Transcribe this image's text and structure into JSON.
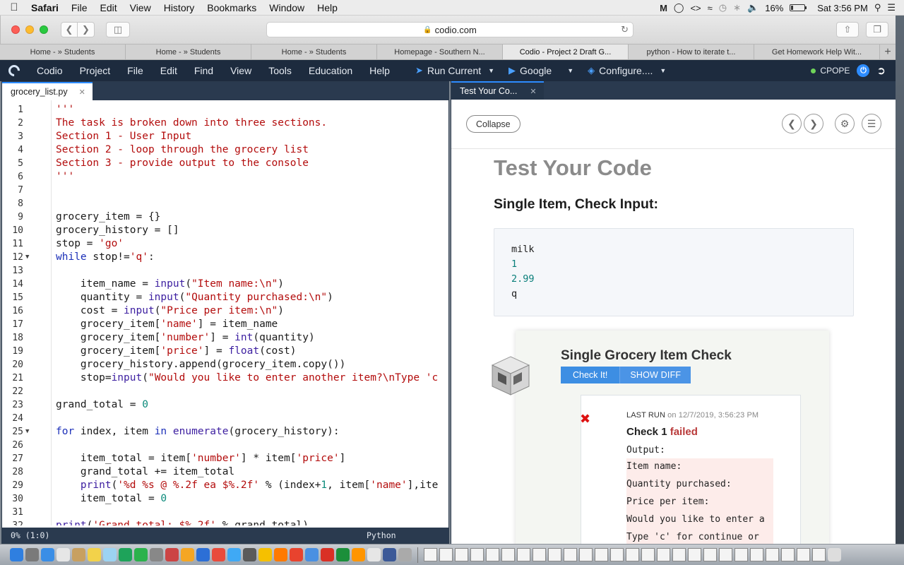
{
  "mac_menubar": {
    "app_name": "Safari",
    "menus": [
      "File",
      "Edit",
      "View",
      "History",
      "Bookmarks",
      "Window",
      "Help"
    ],
    "battery_percent": "16%",
    "battery_level": 0.16,
    "clock": "Sat 3:56 PM"
  },
  "safari": {
    "url": "codio.com",
    "tabs": [
      {
        "label": "Home - » Students",
        "active": false
      },
      {
        "label": "Home - » Students",
        "active": false
      },
      {
        "label": "Home - » Students",
        "active": false
      },
      {
        "label": "Homepage - Southern N...",
        "active": false
      },
      {
        "label": "Codio - Project 2 Draft G...",
        "active": true
      },
      {
        "label": "python - How to iterate t...",
        "active": false
      },
      {
        "label": "Get Homework Help Wit...",
        "active": false
      }
    ],
    "new_tab_label": "+"
  },
  "codio": {
    "menus": [
      "Codio",
      "Project",
      "File",
      "Edit",
      "Find",
      "View",
      "Tools",
      "Education",
      "Help"
    ],
    "run_current_label": "Run Current",
    "google_label": "Google",
    "configure_label": "Configure....",
    "user": "CPOPE"
  },
  "editor": {
    "tab_label": "grocery_list.py",
    "status_position": "0%  (1:0)",
    "status_language": "Python",
    "lines": [
      {
        "n": "1",
        "fold": "",
        "segs": [
          {
            "c": "s",
            "t": "'''"
          }
        ]
      },
      {
        "n": "2",
        "fold": "",
        "segs": [
          {
            "c": "s",
            "t": "The task is broken down into three sections."
          }
        ]
      },
      {
        "n": "3",
        "fold": "",
        "segs": [
          {
            "c": "s",
            "t": "Section 1 - User Input"
          }
        ]
      },
      {
        "n": "4",
        "fold": "",
        "segs": [
          {
            "c": "s",
            "t": "Section 2 - loop through the grocery list"
          }
        ]
      },
      {
        "n": "5",
        "fold": "",
        "segs": [
          {
            "c": "s",
            "t": "Section 3 - provide output to the console"
          }
        ]
      },
      {
        "n": "6",
        "fold": "",
        "segs": [
          {
            "c": "s",
            "t": "'''"
          }
        ]
      },
      {
        "n": "7",
        "fold": "",
        "segs": []
      },
      {
        "n": "8",
        "fold": "",
        "segs": []
      },
      {
        "n": "9",
        "fold": "",
        "segs": [
          {
            "c": "p",
            "t": "grocery_item = {}"
          }
        ]
      },
      {
        "n": "10",
        "fold": "",
        "segs": [
          {
            "c": "p",
            "t": "grocery_history = []"
          }
        ]
      },
      {
        "n": "11",
        "fold": "",
        "segs": [
          {
            "c": "p",
            "t": "stop = "
          },
          {
            "c": "s",
            "t": "'go'"
          }
        ]
      },
      {
        "n": "12",
        "fold": "▼",
        "segs": [
          {
            "c": "k",
            "t": "while"
          },
          {
            "c": "p",
            "t": " stop!="
          },
          {
            "c": "s",
            "t": "'q'"
          },
          {
            "c": "p",
            "t": ":"
          }
        ]
      },
      {
        "n": "13",
        "fold": "",
        "segs": []
      },
      {
        "n": "14",
        "fold": "",
        "segs": [
          {
            "c": "p",
            "t": "    item_name = "
          },
          {
            "c": "f",
            "t": "input"
          },
          {
            "c": "p",
            "t": "("
          },
          {
            "c": "s",
            "t": "\"Item name:\\n\""
          },
          {
            "c": "p",
            "t": ")"
          }
        ]
      },
      {
        "n": "15",
        "fold": "",
        "segs": [
          {
            "c": "p",
            "t": "    quantity = "
          },
          {
            "c": "f",
            "t": "input"
          },
          {
            "c": "p",
            "t": "("
          },
          {
            "c": "s",
            "t": "\"Quantity purchased:\\n\""
          },
          {
            "c": "p",
            "t": ")"
          }
        ]
      },
      {
        "n": "16",
        "fold": "",
        "segs": [
          {
            "c": "p",
            "t": "    cost = "
          },
          {
            "c": "f",
            "t": "input"
          },
          {
            "c": "p",
            "t": "("
          },
          {
            "c": "s",
            "t": "\"Price per item:\\n\""
          },
          {
            "c": "p",
            "t": ")"
          }
        ]
      },
      {
        "n": "17",
        "fold": "",
        "segs": [
          {
            "c": "p",
            "t": "    grocery_item["
          },
          {
            "c": "s",
            "t": "'name'"
          },
          {
            "c": "p",
            "t": "] = item_name"
          }
        ]
      },
      {
        "n": "18",
        "fold": "",
        "segs": [
          {
            "c": "p",
            "t": "    grocery_item["
          },
          {
            "c": "s",
            "t": "'number'"
          },
          {
            "c": "p",
            "t": "] = "
          },
          {
            "c": "f",
            "t": "int"
          },
          {
            "c": "p",
            "t": "(quantity)"
          }
        ]
      },
      {
        "n": "19",
        "fold": "",
        "segs": [
          {
            "c": "p",
            "t": "    grocery_item["
          },
          {
            "c": "s",
            "t": "'price'"
          },
          {
            "c": "p",
            "t": "] = "
          },
          {
            "c": "f",
            "t": "float"
          },
          {
            "c": "p",
            "t": "(cost)"
          }
        ]
      },
      {
        "n": "20",
        "fold": "",
        "segs": [
          {
            "c": "p",
            "t": "    grocery_history.append(grocery_item.copy())"
          }
        ]
      },
      {
        "n": "21",
        "fold": "",
        "segs": [
          {
            "c": "p",
            "t": "    stop="
          },
          {
            "c": "f",
            "t": "input"
          },
          {
            "c": "p",
            "t": "("
          },
          {
            "c": "s",
            "t": "\"Would you like to enter another item?\\nType 'c"
          }
        ]
      },
      {
        "n": "22",
        "fold": "",
        "segs": []
      },
      {
        "n": "23",
        "fold": "",
        "segs": [
          {
            "c": "p",
            "t": "grand_total = "
          },
          {
            "c": "n",
            "t": "0"
          }
        ]
      },
      {
        "n": "24",
        "fold": "",
        "segs": []
      },
      {
        "n": "25",
        "fold": "▼",
        "segs": [
          {
            "c": "k",
            "t": "for"
          },
          {
            "c": "p",
            "t": " index, item "
          },
          {
            "c": "k",
            "t": "in"
          },
          {
            "c": "p",
            "t": " "
          },
          {
            "c": "f",
            "t": "enumerate"
          },
          {
            "c": "p",
            "t": "(grocery_history):"
          }
        ]
      },
      {
        "n": "26",
        "fold": "",
        "segs": []
      },
      {
        "n": "27",
        "fold": "",
        "segs": [
          {
            "c": "p",
            "t": "    item_total = item["
          },
          {
            "c": "s",
            "t": "'number'"
          },
          {
            "c": "p",
            "t": "] * item["
          },
          {
            "c": "s",
            "t": "'price'"
          },
          {
            "c": "p",
            "t": "]"
          }
        ]
      },
      {
        "n": "28",
        "fold": "",
        "segs": [
          {
            "c": "p",
            "t": "    grand_total += item_total"
          }
        ]
      },
      {
        "n": "29",
        "fold": "",
        "segs": [
          {
            "c": "p",
            "t": "    "
          },
          {
            "c": "f",
            "t": "print"
          },
          {
            "c": "p",
            "t": "("
          },
          {
            "c": "s",
            "t": "'%d %s @ %.2f ea $%.2f'"
          },
          {
            "c": "p",
            "t": " % (index+"
          },
          {
            "c": "n",
            "t": "1"
          },
          {
            "c": "p",
            "t": ", item["
          },
          {
            "c": "s",
            "t": "'name'"
          },
          {
            "c": "p",
            "t": "],ite"
          }
        ]
      },
      {
        "n": "30",
        "fold": "",
        "segs": [
          {
            "c": "p",
            "t": "    item_total = "
          },
          {
            "c": "n",
            "t": "0"
          }
        ]
      },
      {
        "n": "31",
        "fold": "",
        "segs": []
      },
      {
        "n": "32",
        "fold": "",
        "segs": [
          {
            "c": "f",
            "t": "print"
          },
          {
            "c": "p",
            "t": "("
          },
          {
            "c": "s",
            "t": "'Grand total: $%.2f'"
          },
          {
            "c": "p",
            "t": " % grand_total)"
          }
        ]
      }
    ]
  },
  "guide": {
    "tab_label": "Test Your Co...",
    "collapse_label": "Collapse",
    "title": "Test Your Code",
    "subtitle": "Single Item, Check Input:",
    "inputs": [
      {
        "t": "milk",
        "c": "text"
      },
      {
        "t": "1",
        "c": "num"
      },
      {
        "t": "2.99",
        "c": "num"
      },
      {
        "t": "q",
        "c": "text"
      }
    ],
    "check": {
      "title": "Single Grocery Item Check",
      "check_button": "Check It!",
      "diff_button": "SHOW DIFF",
      "last_run_label": "LAST RUN",
      "last_run_date": "on 12/7/2019, 3:56:23 PM",
      "status_prefix": "Check 1",
      "status_word": "failed",
      "output_label": "Output:",
      "output_lines": [
        "Item name:",
        "Quantity purchased:",
        "Price per item:",
        "Would you like to enter a",
        "Type 'c' for continue or"
      ]
    }
  }
}
